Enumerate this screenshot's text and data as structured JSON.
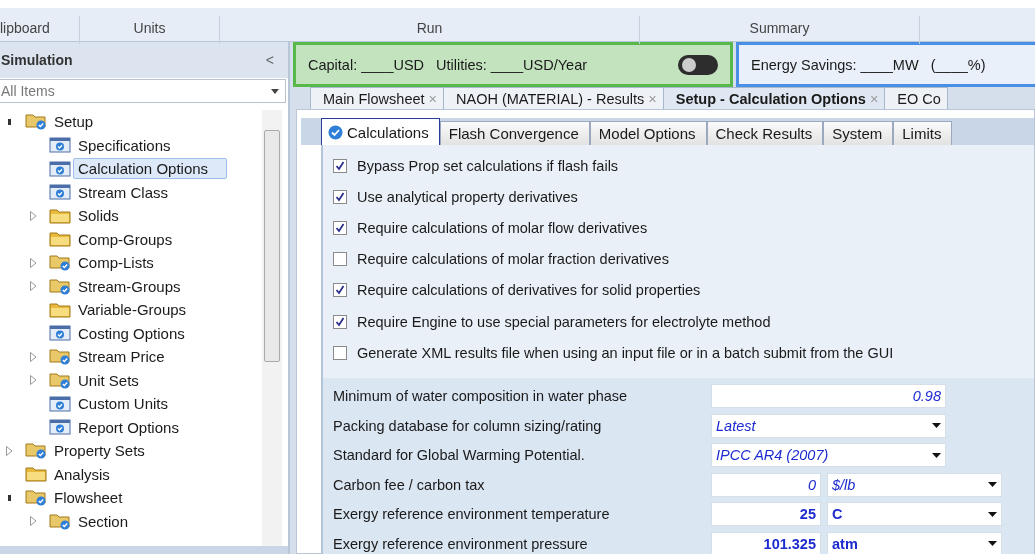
{
  "ribbon": {
    "groups": [
      "lipboard",
      "Units",
      "Run",
      "Summary"
    ]
  },
  "sidebar": {
    "title": "Simulation",
    "collapse": "<",
    "filter": {
      "value": "All Items"
    },
    "tree": [
      {
        "label": "Setup",
        "kind": "folder-check",
        "expanded": true,
        "children": [
          {
            "label": "Specifications",
            "kind": "form",
            "selected": false
          },
          {
            "label": "Calculation Options",
            "kind": "form",
            "selected": true
          },
          {
            "label": "Stream Class",
            "kind": "form",
            "selected": false
          },
          {
            "label": "Solids",
            "kind": "folder",
            "expanded": false,
            "selected": false
          },
          {
            "label": "Comp-Groups",
            "kind": "folder",
            "selected": false
          },
          {
            "label": "Comp-Lists",
            "kind": "folder-check",
            "expanded": false,
            "selected": false
          },
          {
            "label": "Stream-Groups",
            "kind": "folder-check",
            "expanded": false,
            "selected": false
          },
          {
            "label": "Variable-Groups",
            "kind": "folder",
            "selected": false
          },
          {
            "label": "Costing Options",
            "kind": "form",
            "selected": false
          },
          {
            "label": "Stream Price",
            "kind": "folder-check",
            "expanded": false,
            "selected": false
          },
          {
            "label": "Unit Sets",
            "kind": "folder-check",
            "expanded": false,
            "selected": false
          },
          {
            "label": "Custom Units",
            "kind": "form",
            "selected": false
          },
          {
            "label": "Report Options",
            "kind": "form",
            "selected": false
          }
        ],
        "selected": false
      },
      {
        "label": "Property Sets",
        "kind": "folder-check",
        "expanded": false,
        "selected": false
      },
      {
        "label": "Analysis",
        "kind": "folder",
        "selected": false
      },
      {
        "label": "Flowsheet",
        "kind": "folder-check",
        "expanded": true,
        "selected": false,
        "children": [
          {
            "label": "Section",
            "kind": "folder-check",
            "expanded": false,
            "selected": false
          }
        ]
      }
    ]
  },
  "cost_bar": {
    "capital": "Capital: ____USD",
    "utilities": "Utilities: ____USD/Year",
    "on": false
  },
  "energy_bar": {
    "text": "Energy Savings: ____MW   (____%)"
  },
  "doc_tabs": [
    {
      "label": "Main Flowsheet",
      "selected": false
    },
    {
      "label": "NAOH (MATERIAL) - Results",
      "selected": false
    },
    {
      "label": "Setup - Calculation Options",
      "selected": true
    },
    {
      "label": "EO Co",
      "selected": false
    }
  ],
  "close_glyph": "×",
  "tabs": [
    {
      "label": "Calculations",
      "selected": true
    },
    {
      "label": "Flash Convergence",
      "selected": false
    },
    {
      "label": "Model Options",
      "selected": false
    },
    {
      "label": "Check Results",
      "selected": false
    },
    {
      "label": "System",
      "selected": false
    },
    {
      "label": "Limits",
      "selected": false
    }
  ],
  "options": [
    {
      "label": "Bypass Prop set calculations if flash fails",
      "checked": true
    },
    {
      "label": "Use analytical property derivatives",
      "checked": true
    },
    {
      "label": "Require calculations of molar flow derivatives",
      "checked": true
    },
    {
      "label": "Require calculations of molar fraction derivatives",
      "checked": false
    },
    {
      "label": "Require calculations of derivatives for solid properties",
      "checked": true
    },
    {
      "label": "Require Engine to use special parameters for electrolyte method",
      "checked": true
    },
    {
      "label": "Generate XML results file when using an input file or in a batch submit from the GUI",
      "checked": false
    }
  ],
  "fields": [
    {
      "label": "Minimum of water composition in water phase",
      "kind": "number",
      "value": "0.98",
      "entered": false
    },
    {
      "label": "Packing database for column sizing/rating",
      "kind": "select",
      "value": "Latest",
      "entered": false
    },
    {
      "label": "Standard for Global Warming Potential.",
      "kind": "select",
      "value": "IPCC AR4 (2007)",
      "entered": false
    },
    {
      "label": "Carbon fee / carbon tax",
      "kind": "number-unit",
      "value": "0",
      "unit": "$/lb",
      "entered": false
    },
    {
      "label": "Exergy reference environment temperature",
      "kind": "number-unit",
      "value": "25",
      "unit": "C",
      "entered": true
    },
    {
      "label": "Exergy reference environment pressure",
      "kind": "number-unit",
      "value": "101.325",
      "unit": "atm",
      "entered": true
    }
  ]
}
